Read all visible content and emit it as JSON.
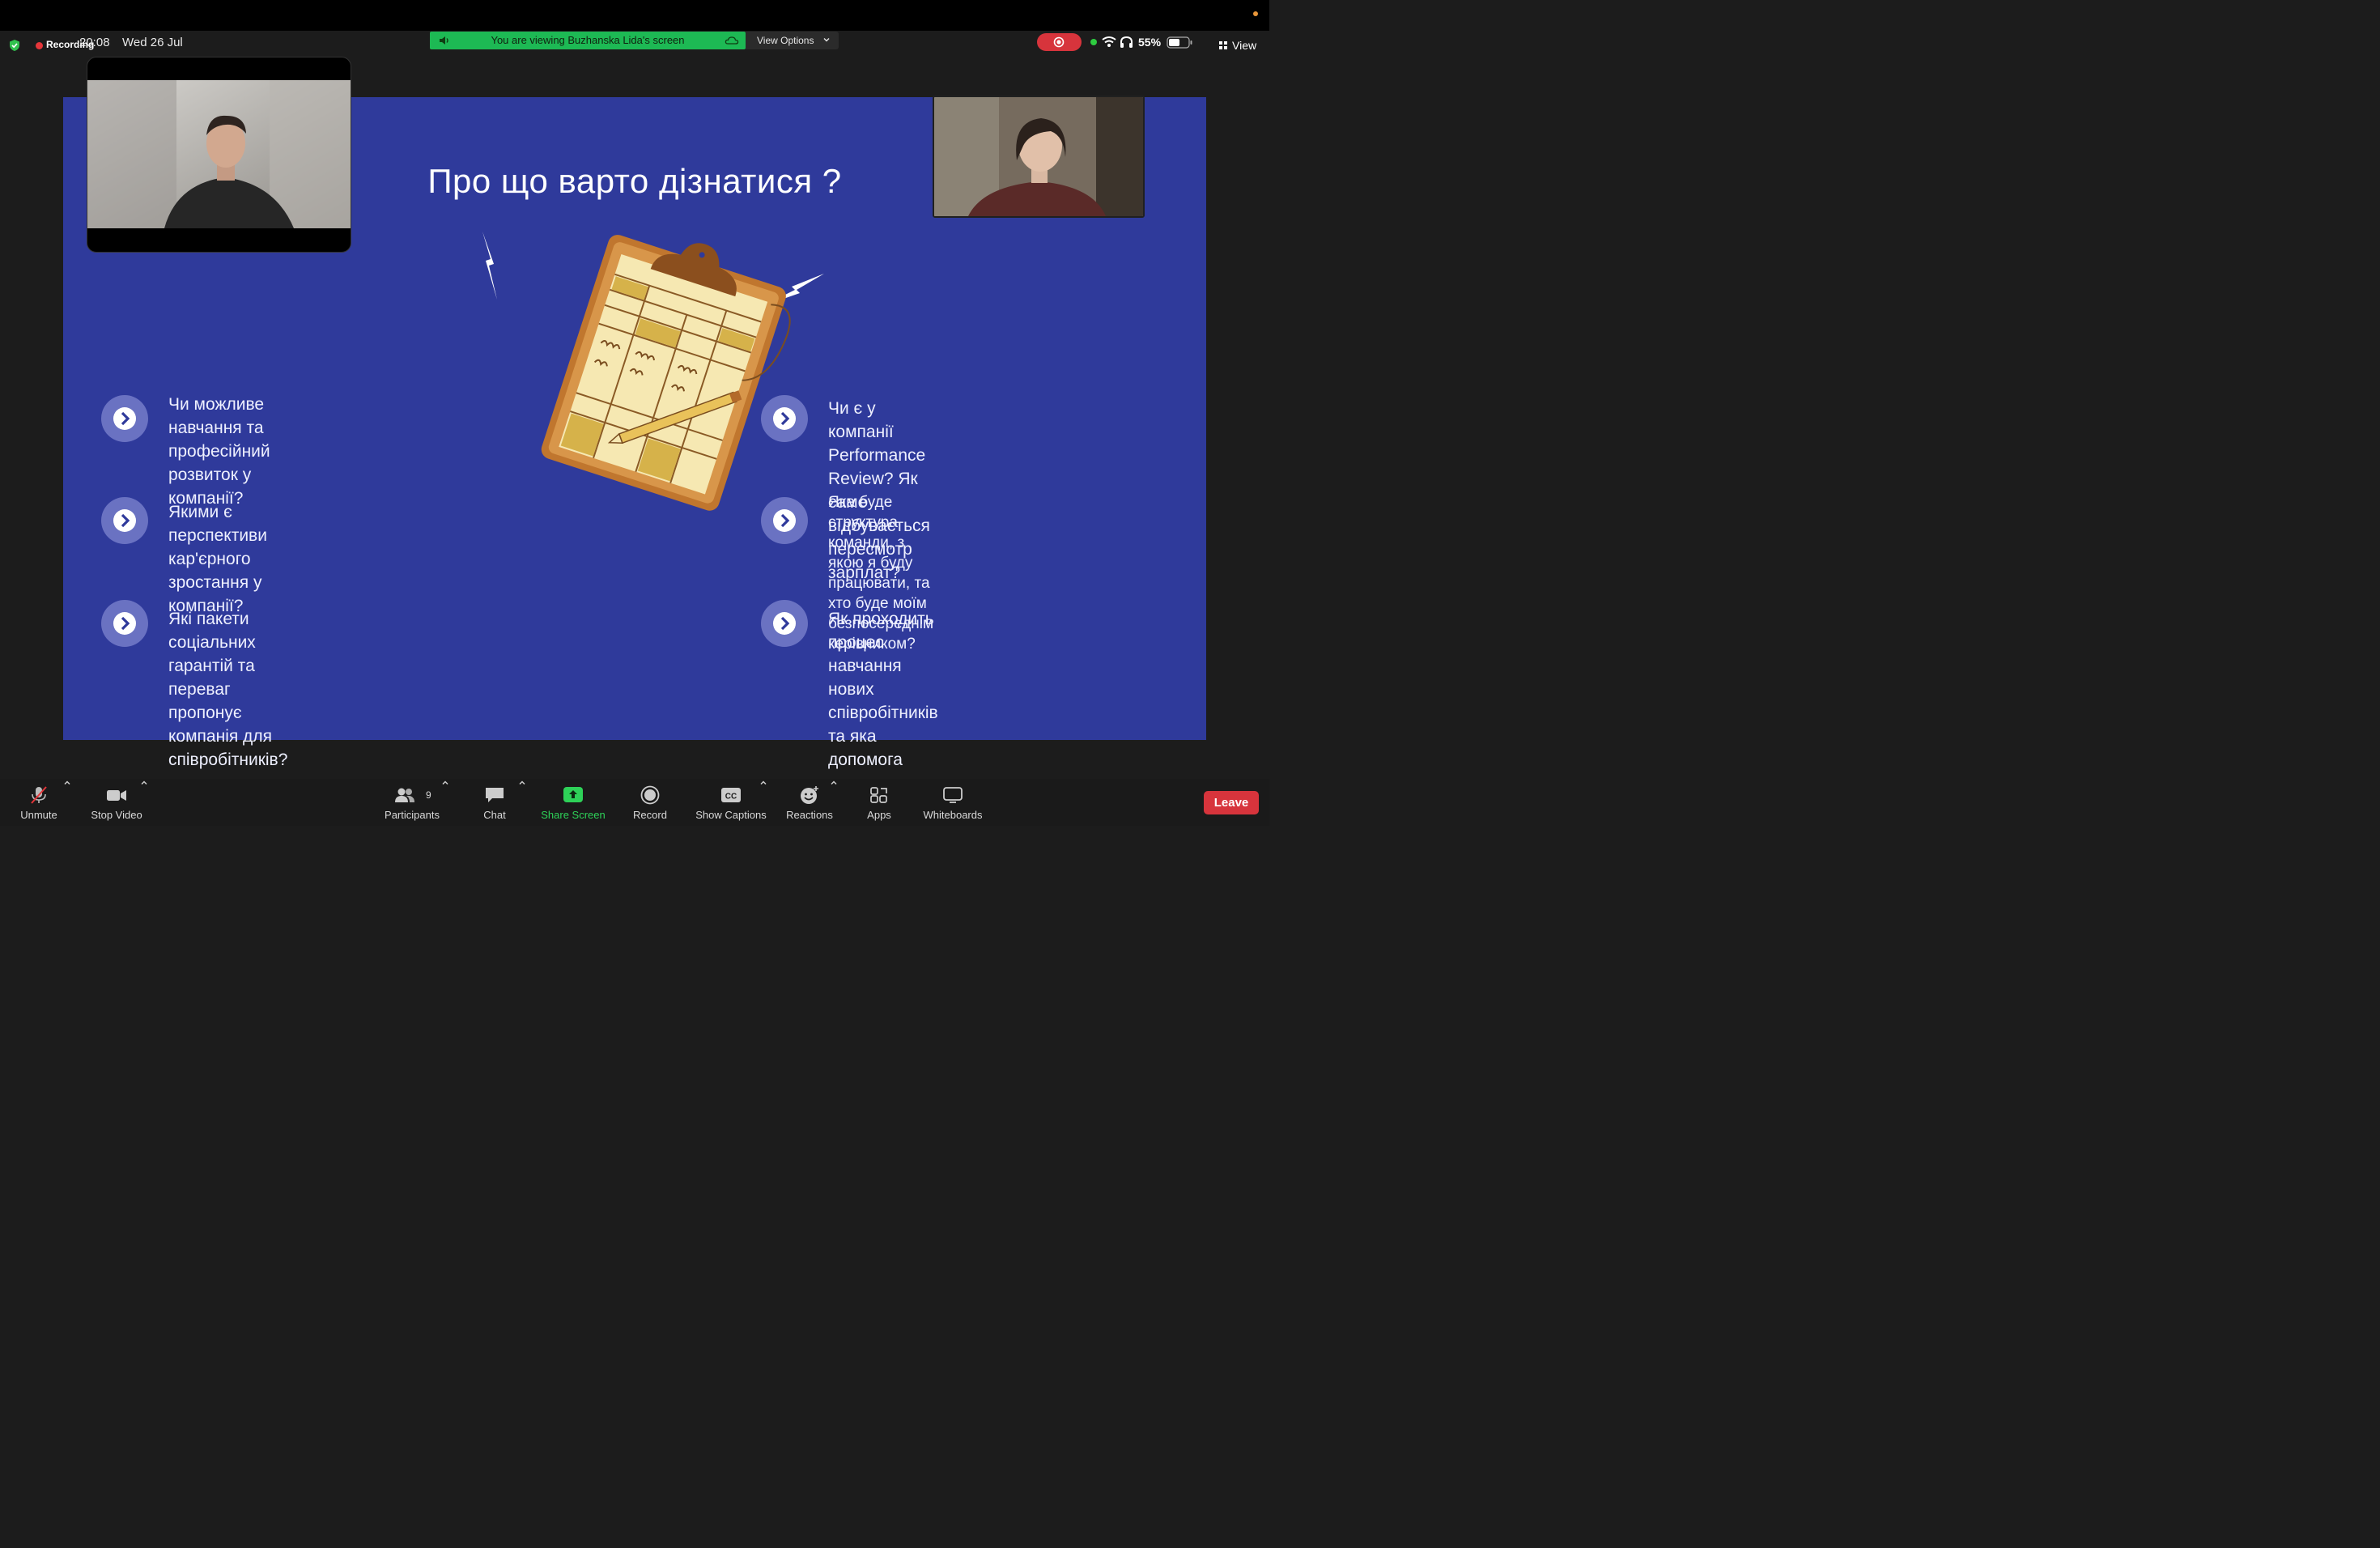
{
  "status_bar": {
    "recording_label": "Recording",
    "time": "20:08",
    "date": "Wed 26 Jul",
    "viewing_notice": "You are viewing Buzhanska Lida's screen",
    "view_options_label": "View Options",
    "battery": "55%",
    "view_label": "View"
  },
  "slide": {
    "title": "Про що варто дізнатися ?",
    "left_items": [
      "Чи можливе навчання та\nпрофесійний розвиток у\nкомпанії?",
      "Якими є перспективи кар'єрного\nзростання у компанії?",
      "Які пакети соціальних гарантій та\nпереваг пропонує компанія для\nспівробітників?"
    ],
    "right_items": [
      "Чи є у компанії Performance Review? Як\nсаме відбувається пересмотр зарплат?",
      "Яка буде структура команди, з якою я буду\nпрацювати, та хто буде моїм безпосереднім\nкерівником?",
      "Як проходить процес навчання нових\nспівробітників та яка допомога\nнадається новачкам?"
    ]
  },
  "toolbar": {
    "unmute": "Unmute",
    "stop_video": "Stop Video",
    "participants": "Participants",
    "participants_count": "9",
    "chat": "Chat",
    "share_screen": "Share Screen",
    "record": "Record",
    "show_captions": "Show Captions",
    "reactions": "Reactions",
    "apps": "Apps",
    "whiteboards": "Whiteboards",
    "leave": "Leave"
  },
  "colors": {
    "slide_bg": "#2f3a9b",
    "bullet": "#6a72c2",
    "share_green": "#2ed158",
    "notice_green": "#1db954",
    "leave_red": "#d7343c",
    "recording_red": "#e5363a"
  },
  "icons": [
    "shield-icon",
    "speaker-icon",
    "cloud-icon",
    "chevron-down-icon",
    "stop-share-icon",
    "wifi-icon",
    "headphones-icon",
    "battery-icon",
    "grid-icon",
    "arrow-right-icon",
    "clipboard-illustration",
    "lightning-icon",
    "muted-mic-icon",
    "video-camera-icon",
    "participants-icon",
    "chat-icon",
    "share-screen-icon",
    "record-icon",
    "captions-icon",
    "reactions-icon",
    "apps-icon",
    "whiteboard-icon"
  ]
}
